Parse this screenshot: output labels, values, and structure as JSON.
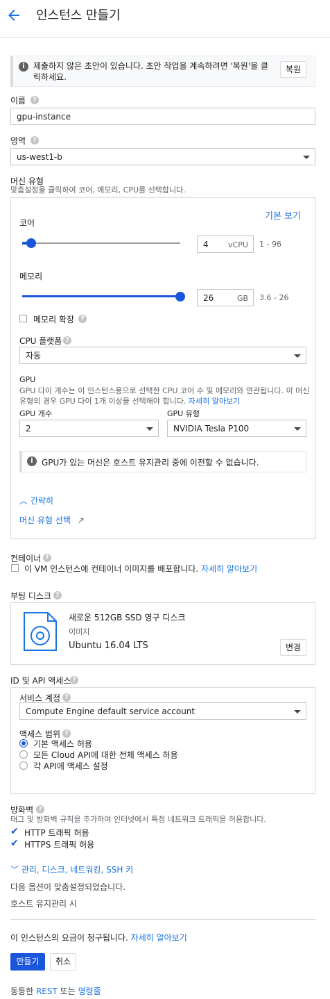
{
  "header": {
    "title": "인스턴스 만들기"
  },
  "notice": {
    "text_line1": "제출하지 않은 초안이 있습니다. 초안 작업을 계속하려면 '복원'을 클",
    "text_line2": "릭하세요.",
    "restore_label": "복원"
  },
  "name": {
    "label": "이름",
    "value": "gpu-instance"
  },
  "zone": {
    "label": "영역",
    "value": "us-west1-b"
  },
  "machine": {
    "label": "머신 유형",
    "subtitle": "맞춤설정을 클릭하여 코어, 메모리, CPU를 선택합니다.",
    "basic_view": "기본 보기",
    "cores": {
      "label": "코어",
      "value": "4",
      "unit": "vCPU",
      "range": "1 - 96",
      "fraction": 0.03
    },
    "memory": {
      "label": "메모리",
      "value": "26",
      "unit": "GB",
      "range": "3.6 - 26",
      "fraction": 1.0
    },
    "extend_memory": "메모리 확장",
    "cpu_platform": {
      "label": "CPU 플랫폼",
      "value": "자동"
    },
    "gpu": {
      "title": "GPU",
      "desc_line1": "GPU 다이 개수는 이 인스턴스용으로 선택한 CPU 코어 수 및 메모리와 연관됩니다. 이 머신",
      "desc_line2": "유형의 경우 GPU 다이 1개 이상을 선택해야 합니다.",
      "learn_more": "자세히 알아보기",
      "count_label": "GPU 개수",
      "count_value": "2",
      "type_label": "GPU 유형",
      "type_value": "NVIDIA Tesla P100",
      "warning": "GPU가 있는 머신은 호스트 유지관리 중에 이전할 수 없습니다."
    },
    "collapse": "간략히",
    "select_type": "머신 유형 선택"
  },
  "container": {
    "label": "컨테이너",
    "checkbox": "이 VM 인스턴스에 컨테이너 이미지를 배포합니다.",
    "learn_more": "자세히 알아보기"
  },
  "boot_disk": {
    "label": "부팅 디스크",
    "title": "새로운 512GB SSD 영구 디스크",
    "image_label": "이미지",
    "image": "Ubuntu 16.04 LTS",
    "change": "변경"
  },
  "identity": {
    "label": "ID 및 API 액세스",
    "service_account_label": "서비스 계정",
    "service_account": "Compute Engine default service account",
    "scope_label": "액세스 범위",
    "scopes": [
      "기본 액세스 허용",
      "모든 Cloud API에 대한 전체 액세스 허용",
      "각 API에 액세스 설정"
    ]
  },
  "firewall": {
    "label": "방화벽",
    "subtitle": "태그 및 방화벽 규칙을 추가하여 인터넷에서 특정 네트워크 트래픽을 허용합니다.",
    "http": "HTTP 트래픽 허용",
    "https": "HTTPS 트래픽 허용"
  },
  "advanced": {
    "link": "관리, 디스크, 네트워킹, SSH 키",
    "customized": "다음 옵션이 맞춤설정되었습니다.",
    "host_maint": "호스트 유지관리 시"
  },
  "billing": {
    "text": "이 인스턴스의 요금이 청구됩니다.",
    "learn_more": "자세히 알아보기"
  },
  "actions": {
    "create": "만들기",
    "cancel": "취소"
  },
  "footer": {
    "prefix": "동등한",
    "rest": "REST",
    "or": "또는",
    "cli": "명령줄"
  }
}
